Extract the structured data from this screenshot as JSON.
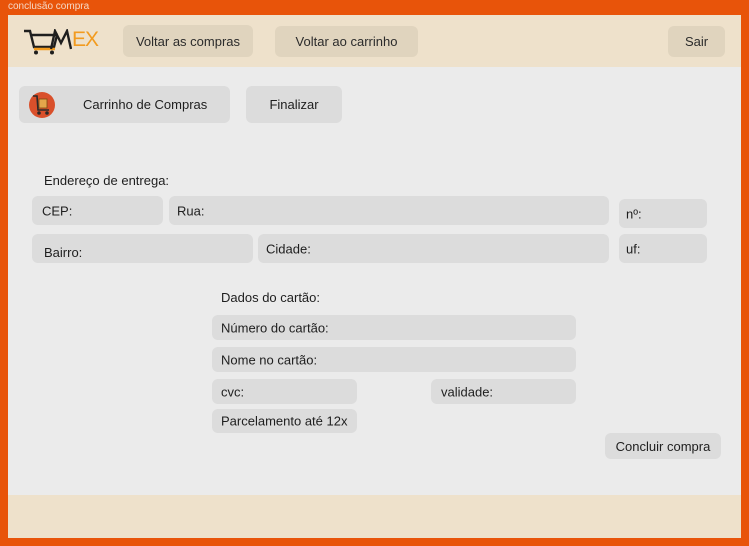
{
  "frame": {
    "title": "conclusão compra"
  },
  "header": {
    "logo_text": "EX",
    "back_to_shopping_label": "Voltar as compras",
    "back_to_cart_label": "Voltar ao carrinho",
    "logout_label": "Sair"
  },
  "toolbar": {
    "cart_label": "Carrinho de Compras",
    "finish_label": "Finalizar"
  },
  "address": {
    "heading": "Endereço de entrega:",
    "cep_label": "CEP:",
    "street_label": "Rua:",
    "number_label": "nº:",
    "district_label": "Bairro:",
    "city_label": "Cidade:",
    "state_label": "uf:"
  },
  "card": {
    "heading": "Dados do cartão:",
    "number_label": "Número do cartão:",
    "name_label": "Nome no cartão:",
    "cvc_label": "cvc:",
    "expiry_label": "validade:",
    "installments_label": "Parcelamento até 12x"
  },
  "actions": {
    "confirm_label": "Concluir compra"
  },
  "colors": {
    "frame": "#E8540A",
    "header_bg": "#EEE1CB",
    "content_bg": "#EBEBEB",
    "field_bg": "#DCDCDC",
    "logo_accent": "#F29B1F"
  }
}
